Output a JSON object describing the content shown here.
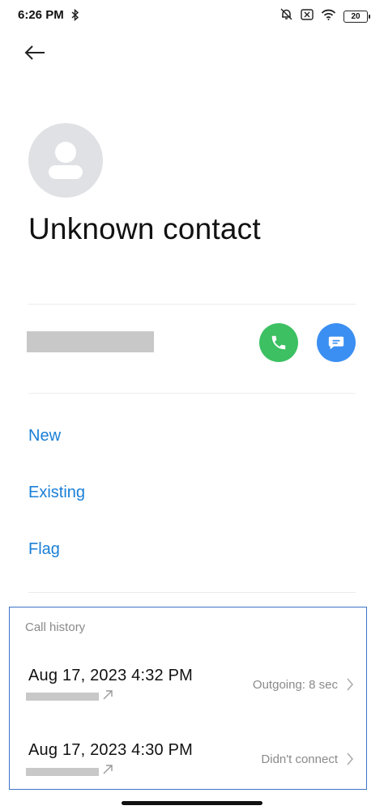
{
  "status_bar": {
    "time": "6:26 PM",
    "battery": "20",
    "icons": [
      "bluetooth-icon",
      "mute-icon",
      "sim-off-icon",
      "wifi-icon",
      "battery-icon"
    ]
  },
  "header": {
    "back_icon": "arrow-left-icon"
  },
  "contact": {
    "name": "Unknown contact",
    "avatar_icon": "person-icon"
  },
  "number_row": {
    "call_icon": "phone-icon",
    "message_icon": "message-icon",
    "call_color": "#3cc062",
    "message_color": "#3b8ff2"
  },
  "actions": {
    "new_label": "New",
    "existing_label": "Existing",
    "flag_label": "Flag",
    "link_color": "#1a7fd6"
  },
  "call_history": {
    "title": "Call history",
    "entries": [
      {
        "datetime": "Aug 17, 2023 4:32 PM",
        "status": "Outgoing: 8 sec",
        "icon": "outgoing-arrow-icon"
      },
      {
        "datetime": "Aug 17, 2023 4:30 PM",
        "status": "Didn't connect",
        "icon": "outgoing-arrow-icon"
      }
    ]
  }
}
